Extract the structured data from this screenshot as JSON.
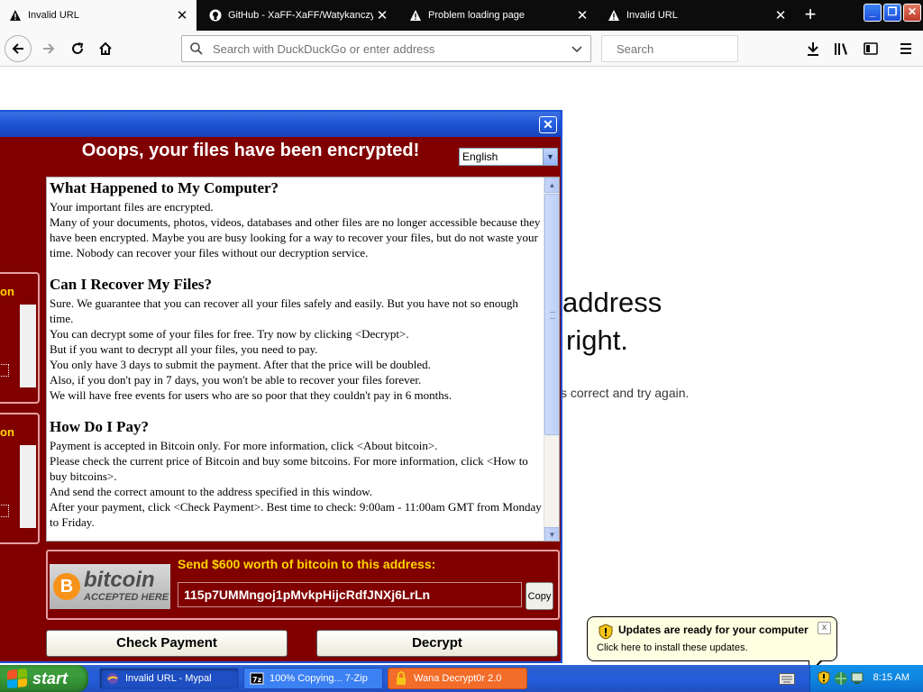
{
  "browser": {
    "tabs": [
      {
        "title": "Invalid URL",
        "icon": "warning-icon",
        "active": true
      },
      {
        "title": "GitHub - XaFF-XaFF/Watykanczy",
        "icon": "github-icon",
        "active": false
      },
      {
        "title": "Problem loading page",
        "icon": "warning-icon",
        "active": false
      },
      {
        "title": "Invalid URL",
        "icon": "warning-icon",
        "active": false
      }
    ],
    "new_tab": "+",
    "urlbar_placeholder": "Search with DuckDuckGo or enter address",
    "search_placeholder": "Search"
  },
  "page": {
    "line1": "address",
    "line2": "right.",
    "line3": "s correct and try again."
  },
  "ransom": {
    "heading": "Ooops, your files have been encrypted!",
    "language": "English",
    "side_label_1": "on",
    "side_label_2": "on",
    "sections": {
      "s1_title": "What Happened to My Computer?",
      "s1_p1": "Your important files are encrypted.",
      "s1_p2": "Many of your documents, photos, videos, databases and other files are no longer accessible because they have been encrypted. Maybe you are busy looking for a way to recover your files, but do not waste your time. Nobody can recover your files without our decryption service.",
      "s2_title": "Can I Recover My Files?",
      "s2_p1": "Sure. We guarantee that you can recover all your files safely and easily. But you have not so enough time.",
      "s2_p2": "You can decrypt some of your files for free. Try now by clicking <Decrypt>.",
      "s2_p3": "But if you want to decrypt all your files, you need to pay.",
      "s2_p4": "You only have 3 days to submit the payment. After that the price will be doubled.",
      "s2_p5": "Also, if you don't pay in 7 days, you won't be able to recover your files forever.",
      "s2_p6": "We will have free events for users who are so poor that they couldn't pay in 6 months.",
      "s3_title": "How Do I Pay?",
      "s3_p1": "Payment is accepted in Bitcoin only. For more information, click <About bitcoin>.",
      "s3_p2": "Please check the current price of Bitcoin and buy some bitcoins. For more information, click <How to buy bitcoins>.",
      "s3_p3": "And send the correct amount to the address specified in this window.",
      "s3_p4": "After your payment, click <Check Payment>. Best time to check: 9:00am - 11:00am GMT from Monday to Friday."
    },
    "bitcoin_logo_word": "bitcoin",
    "bitcoin_logo_sub": "ACCEPTED HERE",
    "send_text": "Send $600 worth of bitcoin to this address:",
    "address": "115p7UMMngoj1pMvkpHijcRdfJNXj6LrLn",
    "copy_label": "Copy",
    "check_payment_label": "Check Payment",
    "decrypt_label": "Decrypt"
  },
  "balloon": {
    "title": "Updates are ready for your computer",
    "body": "Click here to install these updates.",
    "close": "x"
  },
  "taskbar": {
    "start_label": "start",
    "items": [
      {
        "label": "Invalid URL - Mypal",
        "state": "active"
      },
      {
        "label": "100% Copying... 7-Zip",
        "state": "normal"
      },
      {
        "label": "Wana Decrypt0r 2.0",
        "state": "alert"
      }
    ],
    "clock": "8:15 AM"
  },
  "colors": {
    "ransom_bg": "#800000",
    "ransom_yellow": "#ffd700",
    "xp_blue": "#245edb",
    "start_green": "#3a9c3a",
    "balloon_bg": "#ffffe1"
  }
}
